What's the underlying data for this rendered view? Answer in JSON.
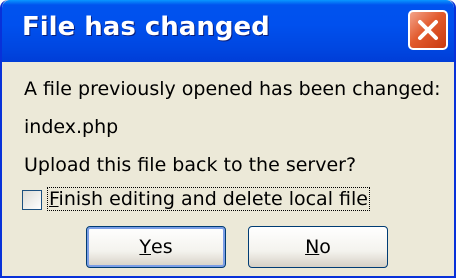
{
  "dialog": {
    "title": "File has changed",
    "close_icon": "close-icon",
    "message_line_1": "A file previously opened has been changed:",
    "file_name": "index.php",
    "message_line_2": "Upload this file back to the server?",
    "checkbox": {
      "label_access_key": "F",
      "label_rest": "inish editing and delete local file",
      "checked": false
    },
    "buttons": {
      "yes_access_key": "Y",
      "yes_rest": "es",
      "no_access_key": "N",
      "no_rest": "o"
    }
  },
  "colors": {
    "titlebar": "#0053ee",
    "close_button": "#e25b2e",
    "dialog_background": "#ece9d8"
  }
}
